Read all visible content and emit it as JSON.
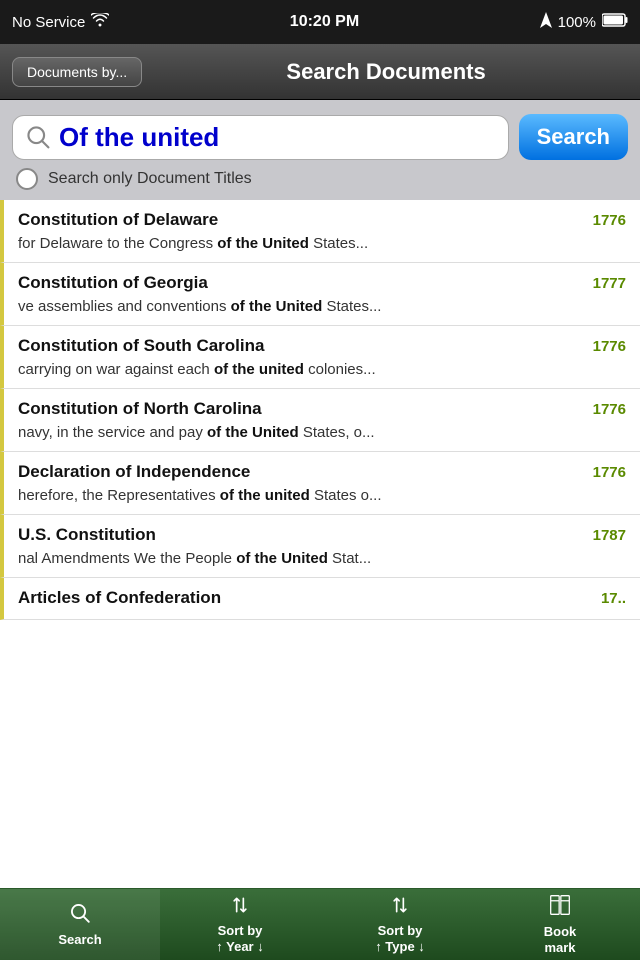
{
  "statusBar": {
    "carrier": "No Service",
    "time": "10:20 PM",
    "battery": "100%"
  },
  "navBar": {
    "backLabel": "Documents by...",
    "title": "Search Documents"
  },
  "searchArea": {
    "queryText": "Of the united",
    "searchPlaceholder": "Search",
    "searchButtonLabel": "Search",
    "filterLabel": "Search only Document Titles"
  },
  "results": [
    {
      "title": "Constitution of Delaware",
      "year": "1776",
      "snippet": "for Delaware to the Congress ",
      "highlightBefore": "for Delaware to the Congress ",
      "highlightText": "of the United",
      "highlightAfter": " States..."
    },
    {
      "title": "Constitution of Georgia",
      "year": "1777",
      "snippet": "ve assemblies and conventions ",
      "highlightBefore": "ve assemblies and conventions ",
      "highlightText": "of the United",
      "highlightAfter": " States..."
    },
    {
      "title": "Constitution of South Carolina",
      "year": "1776",
      "snippet": "carrying on war against each ",
      "highlightBefore": "carrying on war against each ",
      "highlightText": "of the united",
      "highlightAfter": " colonies..."
    },
    {
      "title": "Constitution of North Carolina",
      "year": "1776",
      "snippet": "navy, in the service and pay ",
      "highlightBefore": "navy, in the service and pay ",
      "highlightText": "of the United",
      "highlightAfter": " States, o..."
    },
    {
      "title": "Declaration of Independence",
      "year": "1776",
      "snippet": "herefore, the Representatives ",
      "highlightBefore": "herefore, the Representatives ",
      "highlightText": "of the united",
      "highlightAfter": " States o..."
    },
    {
      "title": "U.S. Constitution",
      "year": "1787",
      "snippet": "nal Amendments We the People  ",
      "highlightBefore": "nal Amendments We the People  ",
      "highlightText": "of the United",
      "highlightAfter": " Stat..."
    },
    {
      "title": "Articles of Confederation",
      "year": "17..",
      "snippet": "",
      "highlightBefore": "",
      "highlightText": "",
      "highlightAfter": ""
    }
  ],
  "tabBar": {
    "tabs": [
      {
        "id": "search",
        "label": "Search",
        "icon": "🔍",
        "active": true
      },
      {
        "id": "sort-year",
        "label": "Sort by\n↑ Year ↓",
        "icon": "⇅",
        "active": false
      },
      {
        "id": "sort-type",
        "label": "Sort by\n↑ Type ↓",
        "icon": "⇅",
        "active": false
      },
      {
        "id": "bookmark",
        "label": "Book\nmark",
        "icon": "📖",
        "active": false
      }
    ]
  }
}
